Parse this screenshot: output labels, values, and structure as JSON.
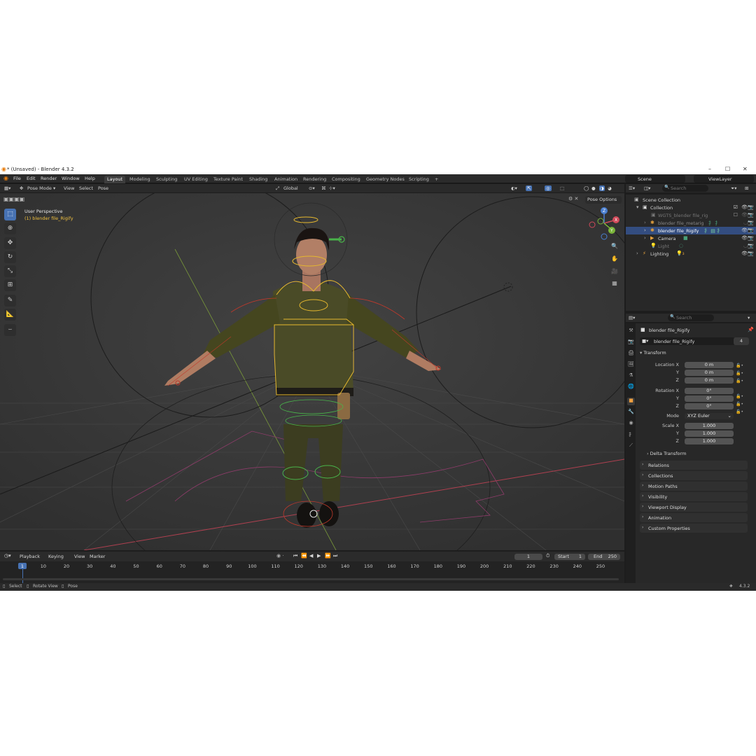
{
  "window": {
    "title": "* (Unsaved) - Blender 4.3.2",
    "controls": [
      "–",
      "☐",
      "✕"
    ]
  },
  "topbar": {
    "menus": [
      "File",
      "Edit",
      "Render",
      "Window",
      "Help"
    ],
    "workspaces": [
      "Layout",
      "Modeling",
      "Sculpting",
      "UV Editing",
      "Texture Paint",
      "Shading",
      "Animation",
      "Rendering",
      "Compositing",
      "Geometry Nodes",
      "Scripting"
    ],
    "add_tab": "+",
    "scene_label": "Scene",
    "viewlayer_label": "ViewLayer"
  },
  "viewport_header": {
    "mode": "Pose Mode",
    "menus": [
      "View",
      "Select",
      "Pose"
    ],
    "transform_orientation": "Global",
    "pose_options": "Pose Options"
  },
  "viewport": {
    "perspective_label": "User Perspective",
    "object_label": "(1) blender file_Rigify",
    "gizmo": {
      "x": "X",
      "y": "Y",
      "z": "Z"
    }
  },
  "outliner": {
    "search_placeholder": "Search",
    "rows": [
      {
        "label": "Scene Collection",
        "indent": 0,
        "icon": "collection-icon"
      },
      {
        "label": "Collection",
        "indent": 1,
        "icon": "collection-icon"
      },
      {
        "label": "WGTS_blender file_rig",
        "indent": 2,
        "icon": "collection-icon",
        "dim": true
      },
      {
        "label": "blender file_metarig",
        "indent": 2,
        "icon": "armature-icon",
        "dim": true
      },
      {
        "label": "blender file_Rigify",
        "indent": 2,
        "icon": "armature-icon",
        "selected": true
      },
      {
        "label": "Camera",
        "indent": 2,
        "icon": "camera-icon"
      },
      {
        "label": "Light",
        "indent": 2,
        "icon": "light-icon",
        "dim": true
      },
      {
        "label": "Lighting",
        "indent": 1,
        "icon": "light-icon"
      }
    ]
  },
  "properties": {
    "search_placeholder": "Search",
    "object_title": "blender file_Rigify",
    "object_name": "blender file_Rigify",
    "users": "4",
    "transform_header": "Transform",
    "location_label": "Location X",
    "location": [
      "0 m",
      "0 m",
      "0 m"
    ],
    "rotation_label": "Rotation X",
    "rotation": [
      "0°",
      "0°",
      "0°"
    ],
    "mode_label": "Mode",
    "mode_value": "XYZ Euler",
    "scale_label": "Scale X",
    "scale": [
      "1.000",
      "1.000",
      "1.000"
    ],
    "axis_y": "Y",
    "axis_z": "Z",
    "delta_transform": "Delta Transform",
    "panels": [
      "Relations",
      "Collections",
      "Motion Paths",
      "Visibility",
      "Viewport Display",
      "Animation",
      "Custom Properties"
    ]
  },
  "timeline": {
    "menus": [
      "Playback",
      "Keying",
      "View",
      "Marker"
    ],
    "current_frame": "1",
    "start_label": "Start",
    "start": "1",
    "end_label": "End",
    "end": "250",
    "ticks": [
      "1",
      "10",
      "20",
      "30",
      "40",
      "50",
      "60",
      "70",
      "80",
      "90",
      "100",
      "110",
      "120",
      "130",
      "140",
      "150",
      "160",
      "170",
      "180",
      "190",
      "200",
      "210",
      "220",
      "230",
      "240",
      "250"
    ]
  },
  "statusbar": {
    "select": "Select",
    "rotate_view": "Rotate View",
    "pose": "Pose",
    "version": "4.3.2"
  },
  "colors": {
    "accent": "#4772b3",
    "bone_yellow": "#e6b82e",
    "bone_green": "#49b34a",
    "bone_red": "#c0392b",
    "selected_text": "#f0c040"
  }
}
